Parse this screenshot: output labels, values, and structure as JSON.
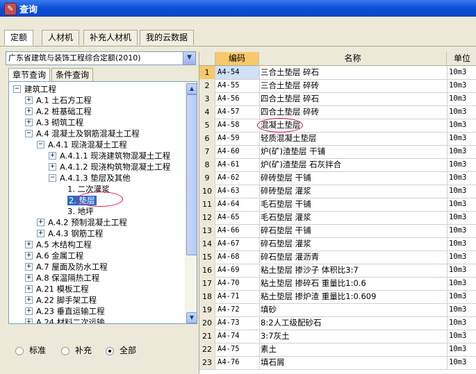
{
  "window": {
    "title": "查询"
  },
  "tabs": [
    {
      "label": "定额",
      "active": true
    },
    {
      "label": "人材机",
      "active": false
    },
    {
      "label": "补充人材机",
      "active": false
    },
    {
      "label": "我的云数据",
      "active": false
    }
  ],
  "left": {
    "dropdown_value": "广东省建筑与装饰工程综合定额(2010)",
    "subtabs": [
      {
        "label": "章节查询",
        "active": true
      },
      {
        "label": "条件查询",
        "active": false
      }
    ],
    "tree": [
      {
        "level": 0,
        "pm": "−",
        "label": "建筑工程"
      },
      {
        "level": 1,
        "pm": "+",
        "label": "A.1 土石方工程"
      },
      {
        "level": 1,
        "pm": "+",
        "label": "A.2 桩基础工程"
      },
      {
        "level": 1,
        "pm": "+",
        "label": "A.3 砌筑工程"
      },
      {
        "level": 1,
        "pm": "−",
        "label": "A.4 混凝土及钢筋混凝土工程"
      },
      {
        "level": 2,
        "pm": "−",
        "label": "A.4.1 现浇混凝土工程"
      },
      {
        "level": 3,
        "pm": "+",
        "label": "A.4.1.1 现浇建筑物混凝土工程"
      },
      {
        "level": 3,
        "pm": "+",
        "label": "A.4.1.2 现浇构筑物混凝土工程"
      },
      {
        "level": 3,
        "pm": "−",
        "label": "A.4.1.3 垫层及其他"
      },
      {
        "level": 4,
        "pm": "",
        "label": "1. 二次灌浆"
      },
      {
        "level": 4,
        "pm": "",
        "label": "2. 垫层",
        "selected": true
      },
      {
        "level": 4,
        "pm": "",
        "label": "3. 地坪"
      },
      {
        "level": 2,
        "pm": "+",
        "label": "A.4.2 预制混凝土工程"
      },
      {
        "level": 2,
        "pm": "+",
        "label": "A.4.3 钢筋工程"
      },
      {
        "level": 1,
        "pm": "+",
        "label": "A.5 木结构工程"
      },
      {
        "level": 1,
        "pm": "+",
        "label": "A.6 金属工程"
      },
      {
        "level": 1,
        "pm": "+",
        "label": "A.7 屋面及防水工程"
      },
      {
        "level": 1,
        "pm": "+",
        "label": "A.8 保温隔热工程"
      },
      {
        "level": 1,
        "pm": "+",
        "label": "A.21 模板工程"
      },
      {
        "level": 1,
        "pm": "+",
        "label": "A.22 脚手架工程"
      },
      {
        "level": 1,
        "pm": "+",
        "label": "A.23 垂直运输工程"
      },
      {
        "level": 1,
        "pm": "+",
        "label": "A.24 材料二次运输"
      }
    ],
    "radios": [
      {
        "label": "标准",
        "checked": false
      },
      {
        "label": "补充",
        "checked": false
      },
      {
        "label": "全部",
        "checked": true
      }
    ]
  },
  "grid": {
    "headers": {
      "code": "编码",
      "name": "名称",
      "unit": "单位"
    },
    "rows": [
      {
        "n": "1",
        "code": "A4-54",
        "name": "三合土垫层 碎石",
        "unit": "10m3"
      },
      {
        "n": "2",
        "code": "A4-55",
        "name": "三合土垫层 碎砖",
        "unit": "10m3"
      },
      {
        "n": "3",
        "code": "A4-56",
        "name": "四合土垫层 碎石",
        "unit": "10m3"
      },
      {
        "n": "4",
        "code": "A4-57",
        "name": "四合土垫层 碎砖",
        "unit": "10m3"
      },
      {
        "n": "5",
        "code": "A4-58",
        "name": "混凝土垫层",
        "unit": "10m3"
      },
      {
        "n": "6",
        "code": "A4-59",
        "name": "轻质混凝土垫层",
        "unit": "10m3"
      },
      {
        "n": "7",
        "code": "A4-60",
        "name": "炉(矿)渣垫层 干铺",
        "unit": "10m3"
      },
      {
        "n": "8",
        "code": "A4-61",
        "name": "炉(矿)渣垫层 石灰拌合",
        "unit": "10m3"
      },
      {
        "n": "9",
        "code": "A4-62",
        "name": "碎砖垫层 干铺",
        "unit": "10m3"
      },
      {
        "n": "10",
        "code": "A4-63",
        "name": "碎砖垫层 灌浆",
        "unit": "10m3"
      },
      {
        "n": "11",
        "code": "A4-64",
        "name": "毛石垫层 干铺",
        "unit": "10m3"
      },
      {
        "n": "12",
        "code": "A4-65",
        "name": "毛石垫层 灌浆",
        "unit": "10m3"
      },
      {
        "n": "13",
        "code": "A4-66",
        "name": "碎石垫层 干铺",
        "unit": "10m3"
      },
      {
        "n": "14",
        "code": "A4-67",
        "name": "碎石垫层 灌浆",
        "unit": "10m3"
      },
      {
        "n": "15",
        "code": "A4-68",
        "name": "碎石垫层 灌沥青",
        "unit": "10m3"
      },
      {
        "n": "16",
        "code": "A4-69",
        "name": "粘土垫层 掺沙子 体积比3:7",
        "unit": "10m3"
      },
      {
        "n": "17",
        "code": "A4-70",
        "name": "粘土垫层 掺碎石 重量比1:0.6",
        "unit": "10m3"
      },
      {
        "n": "18",
        "code": "A4-71",
        "name": "粘土垫层 掺炉渣 重量比1:0.609",
        "unit": "10m3"
      },
      {
        "n": "19",
        "code": "A4-72",
        "name": "填砂",
        "unit": "10m3"
      },
      {
        "n": "20",
        "code": "A4-73",
        "name": "8:2人工级配砂石",
        "unit": "10m3"
      },
      {
        "n": "21",
        "code": "A4-74",
        "name": "3:7灰土",
        "unit": "10m3"
      },
      {
        "n": "22",
        "code": "A4-75",
        "name": "素土",
        "unit": "10m3"
      },
      {
        "n": "23",
        "code": "A4-76",
        "name": "填石屑",
        "unit": "10m3"
      }
    ]
  }
}
